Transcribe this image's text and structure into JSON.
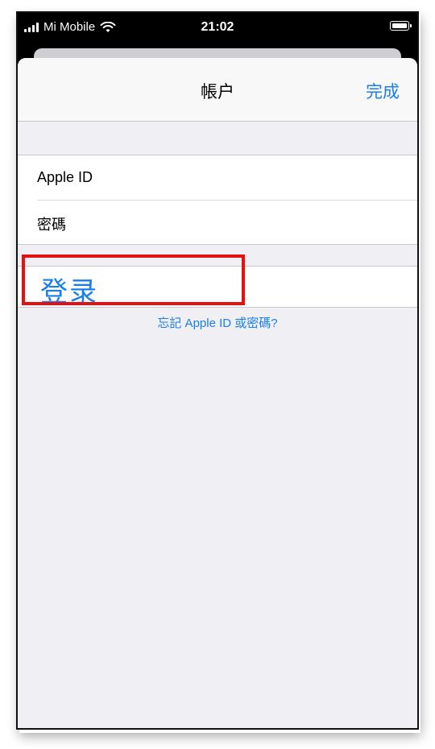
{
  "status_bar": {
    "carrier": "Mi Mobile",
    "time": "21:02"
  },
  "nav": {
    "title": "帳户",
    "done_label": "完成"
  },
  "fields": [
    {
      "label": "Apple ID"
    },
    {
      "label": "密碼"
    }
  ],
  "login_label": "登录",
  "forgot_link": "忘記 Apple ID 或密碼?",
  "colors": {
    "accent": "#1a7ee8",
    "highlight": "#e21212",
    "background": "#efeff4"
  }
}
